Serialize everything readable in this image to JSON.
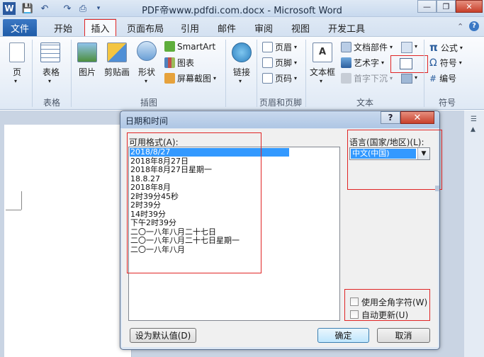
{
  "window": {
    "title": "PDF帝www.pdfdi.com.docx - Microsoft Word",
    "min_icon": "minimize-icon",
    "max_icon": "restore-icon",
    "close_icon": "close-icon"
  },
  "tabs": [
    "文件",
    "开始",
    "插入",
    "页面布局",
    "引用",
    "邮件",
    "审阅",
    "视图",
    "开发工具"
  ],
  "ribbon": {
    "pages": {
      "label": "页",
      "group": ""
    },
    "table": {
      "label": "表格",
      "group": "表格"
    },
    "illustrations": {
      "picture": "图片",
      "clipart": "剪贴画",
      "shapes": "形状",
      "smartart": "SmartArt",
      "chart": "图表",
      "screenshot": "屏幕截图",
      "group": "插图"
    },
    "links": {
      "label": "链接",
      "group": ""
    },
    "header_footer": {
      "header": "页眉",
      "footer": "页脚",
      "page_number": "页码",
      "group": "页眉和页脚"
    },
    "text": {
      "textbox": "文本框",
      "quickparts": "文档部件",
      "wordart": "艺术字",
      "dropcap": "首字下沉",
      "group": "文本"
    },
    "symbols": {
      "equation": "公式",
      "symbol": "符号",
      "number": "编号",
      "group": "符号"
    }
  },
  "dialog": {
    "title": "日期和时间",
    "help": "?",
    "close": "✕",
    "formats_label": "可用格式(A):",
    "formats": [
      "2018/8/27",
      "2018年8月27日",
      "2018年8月27日星期一",
      "18.8.27",
      "2018年8月",
      "2时39分45秒",
      "2时39分",
      "14时39分",
      "下午2时39分",
      "二〇一八年八月二十七日",
      "二〇一八年八月二十七日星期一",
      "二〇一八年八月"
    ],
    "selected_format_index": 0,
    "language_label": "语言(国家/地区)(L):",
    "language_value": "中文(中国)",
    "fullwidth_label": "使用全角字符(W)",
    "autoupdate_label": "自动更新(U)",
    "fullwidth_checked": false,
    "autoupdate_checked": false,
    "set_default": "设为默认值(D)",
    "ok": "确定",
    "cancel": "取消"
  },
  "colors": {
    "highlight": "#3399ff",
    "annotation": "#e02525",
    "file_tab": "#2b67b4"
  }
}
